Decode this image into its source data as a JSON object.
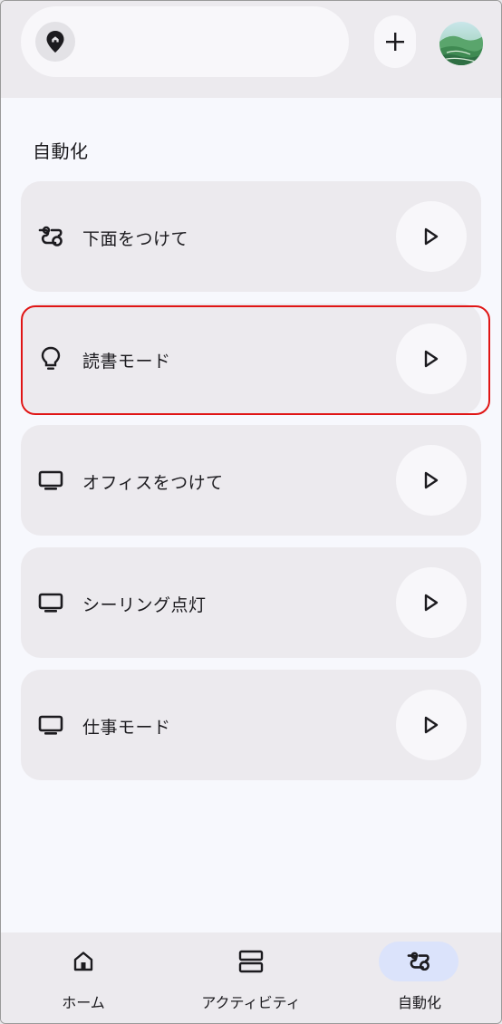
{
  "header": {
    "home_icon": "home-pin-icon",
    "add_icon": "plus-icon",
    "avatar_icon": "avatar-landscape"
  },
  "section_title": "自動化",
  "automations": [
    {
      "label": "下面をつけて",
      "icon": "automation-icon"
    },
    {
      "label": "読書モード",
      "icon": "lightbulb-icon"
    },
    {
      "label": "オフィスをつけて",
      "icon": "tv-icon"
    },
    {
      "label": "シーリング点灯",
      "icon": "tv-icon"
    },
    {
      "label": "仕事モード",
      "icon": "tv-icon"
    }
  ],
  "bottom_nav": [
    {
      "label": "ホーム",
      "icon": "home-icon",
      "active": false
    },
    {
      "label": "アクティビティ",
      "icon": "activity-icon",
      "active": false
    },
    {
      "label": "自動化",
      "icon": "automation-icon",
      "active": true
    }
  ],
  "colors": {
    "highlight": "#e01515",
    "active_nav": "#dbe3fb",
    "card": "#eceaee"
  }
}
